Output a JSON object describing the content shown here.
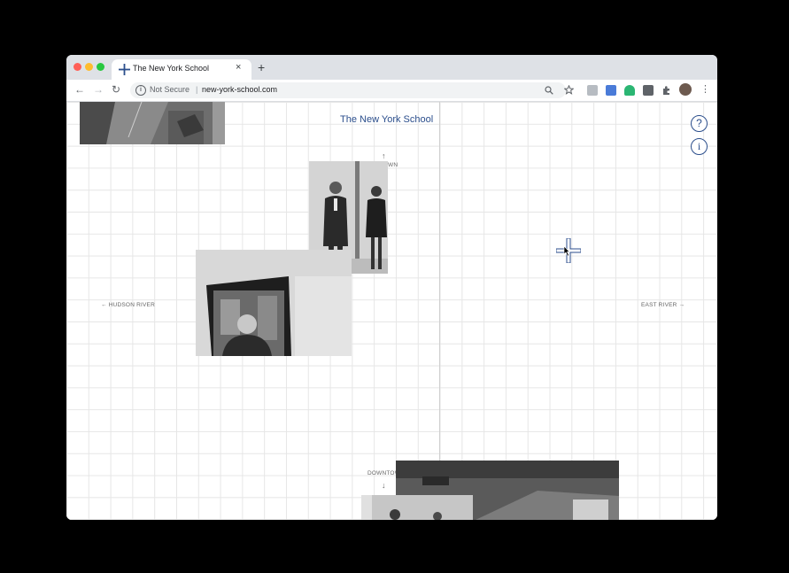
{
  "browser": {
    "tab_title": "The New York School",
    "new_tab_symbol": "+",
    "close_symbol": "×",
    "back_symbol": "←",
    "forward_symbol": "→",
    "reload_symbol": "↻",
    "security_label": "Not Secure",
    "separator": "|",
    "url": "new-york-school.com",
    "zoom_icon": "magnifier-icon",
    "bookmark_icon": "star-icon",
    "menu_symbol": "⋮"
  },
  "page": {
    "title": "The New York School",
    "help_symbol": "?",
    "about_symbol": "i",
    "directions": {
      "up_arrow": "↑",
      "uptown_partial": "WN",
      "hudson": "HUDSON RIVER",
      "hudson_arrow": "←",
      "east": "EAST RIVER",
      "east_arrow": "→",
      "downtown_partial": "DOWNTOW",
      "down_arrow": "↓"
    },
    "accent_color": "#2b4e8c"
  }
}
